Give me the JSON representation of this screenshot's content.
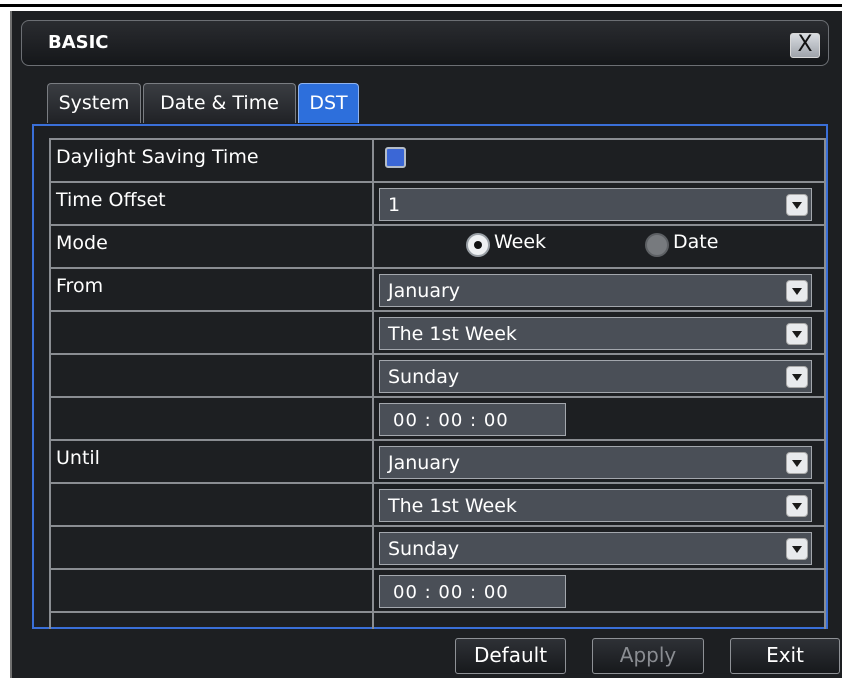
{
  "window": {
    "title": "BASIC",
    "close_label": "X"
  },
  "tabs": [
    {
      "label": "System",
      "active": false
    },
    {
      "label": "Date & Time",
      "active": false
    },
    {
      "label": "DST",
      "active": true
    }
  ],
  "dst": {
    "daylight_saving": {
      "label": "Daylight Saving Time",
      "checked": true
    },
    "time_offset": {
      "label": "Time Offset",
      "value": "1"
    },
    "mode": {
      "label": "Mode",
      "options": [
        "Week",
        "Date"
      ],
      "selected": "Week"
    },
    "from": {
      "label": "From",
      "month": "January",
      "week": "The 1st Week",
      "day": "Sunday",
      "time": "00 : 00 : 00"
    },
    "until": {
      "label": "Until",
      "month": "January",
      "week": "The 1st Week",
      "day": "Sunday",
      "time": "00 : 00 : 00"
    }
  },
  "buttons": {
    "default": "Default",
    "apply": "Apply",
    "exit": "Exit"
  },
  "colors": {
    "accent": "#2d6fdc",
    "background": "#1d1f22",
    "field": "#4a4f57",
    "border": "#8a8d92"
  }
}
